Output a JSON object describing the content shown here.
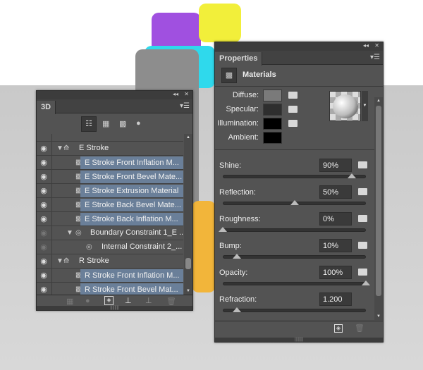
{
  "panel3d": {
    "tab": "3D",
    "header_controls": {
      "collapse": "◂◂",
      "close": "✕"
    },
    "filter_icons": [
      "scene-icon",
      "mesh-icon",
      "material-icon",
      "light-icon"
    ],
    "rows": [
      {
        "type": "group",
        "label": "E Stroke",
        "visible": true
      },
      {
        "type": "material",
        "label": "E Stroke Front Inflation M...",
        "visible": true
      },
      {
        "type": "material",
        "label": "E Stroke Front Bevel Mate...",
        "visible": true
      },
      {
        "type": "material",
        "label": "E Stroke Extrusion Material",
        "visible": true
      },
      {
        "type": "material",
        "label": "E Stroke Back Bevel Mate...",
        "visible": true
      },
      {
        "type": "material",
        "label": "E Stroke Back Inflation M...",
        "visible": true
      },
      {
        "type": "constraint",
        "label": "Boundary Constraint 1_E ...",
        "visible": false
      },
      {
        "type": "subconstraint",
        "label": "Internal Constraint 2_...",
        "visible": false
      },
      {
        "type": "group",
        "label": "R Stroke",
        "visible": true
      },
      {
        "type": "material",
        "label": "R Stroke Front Inflation M...",
        "visible": true
      },
      {
        "type": "material",
        "label": "R Stroke Front Bevel Mat...",
        "visible": true
      }
    ],
    "footer_icons": [
      "mesh-icon",
      "light-icon",
      "render-icon",
      "ground-icon",
      "remove-ground-icon",
      "trash-icon"
    ]
  },
  "properties": {
    "tab": "Properties",
    "section": "Materials",
    "colors": [
      {
        "label": "Diffuse:",
        "color": "#7a7a7a"
      },
      {
        "label": "Specular:",
        "color": "#2e2e2e"
      },
      {
        "label": "Illumination:",
        "color": "#000000"
      },
      {
        "label": "Ambient:",
        "color": "#000000"
      }
    ],
    "sliders": [
      {
        "label": "Shine:",
        "value": "90%",
        "level": 0.9
      },
      {
        "label": "Reflection:",
        "value": "50%",
        "level": 0.5
      },
      {
        "label": "Roughness:",
        "value": "0%",
        "level": 0
      },
      {
        "label": "Bump:",
        "value": "10%",
        "level": 0.1
      },
      {
        "label": "Opacity:",
        "value": "100%",
        "level": 1
      },
      {
        "label": "Refraction:",
        "value": "1.200",
        "level": 0.1
      }
    ]
  }
}
